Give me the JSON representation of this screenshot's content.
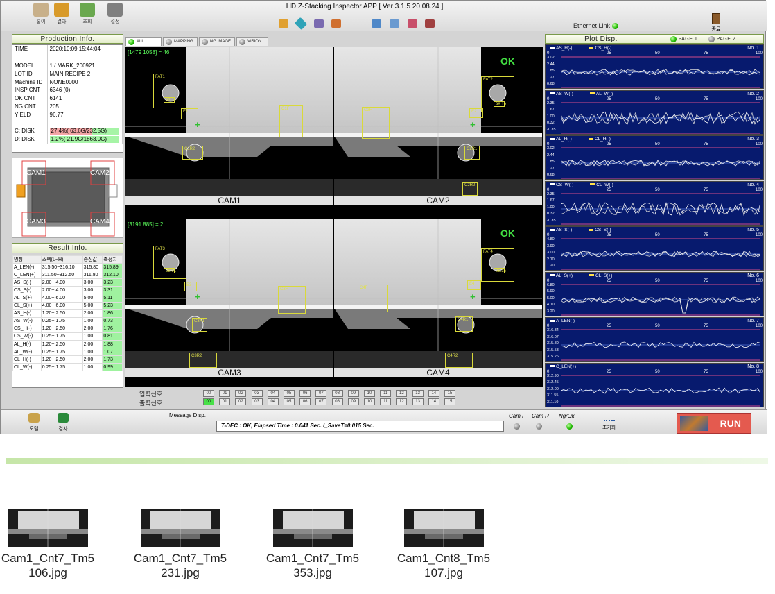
{
  "app": {
    "title": "HD  Z-Stacking Inspector APP  [ Ver 3.1.5 20.08.24 ]",
    "ethernet_label": "Ethernet Link",
    "exit_label": "종료"
  },
  "toolbar": [
    {
      "icon": "home-icon",
      "label": "홈이"
    },
    {
      "icon": "result-icon",
      "label": "결과"
    },
    {
      "icon": "search-icon",
      "label": "조회"
    },
    {
      "icon": "settings-icon",
      "label": "설정"
    }
  ],
  "production": {
    "title": "Production Info.",
    "rows": [
      {
        "k": "TIME",
        "v": "2020:10:09  15:44:04"
      },
      {
        "k": "",
        "v": ""
      },
      {
        "k": "MODEL",
        "v": "1 / MARK_200921"
      },
      {
        "k": "LOT ID",
        "v": "MAIN RECIPE 2"
      },
      {
        "k": "Machine ID",
        "v": "NONE0000"
      },
      {
        "k": "INSP CNT",
        "v": "6346 (0)"
      },
      {
        "k": "OK CNT",
        "v": "6141"
      },
      {
        "k": "NG CNT",
        "v": "205"
      },
      {
        "k": "YIELD",
        "v": "96.77"
      },
      {
        "k": "",
        "v": ""
      },
      {
        "k": "C: DISK",
        "v": "27.4%( 63.6G/232.5G)",
        "fill": 0.274,
        "color": "#f4a6a6"
      },
      {
        "k": "D: DISK",
        "v": "1.2%( 21.9G/1863.0G)",
        "fill": 0.012,
        "color": "#a6f4a6"
      }
    ]
  },
  "camlayout": [
    "CAM1",
    "CAM2",
    "CAM3",
    "CAM4"
  ],
  "result": {
    "title": "Result Info.",
    "headers": [
      "명칭",
      "스펙(L~H)",
      "중심값",
      "측정치"
    ],
    "rows": [
      [
        "A_LEN(-)",
        "315.50~316.10",
        "315.80",
        "315.89"
      ],
      [
        "C_LEN(+)",
        "311.50~312.50",
        "311.80",
        "312.10"
      ],
      [
        "AS_S(-)",
        "2.00~ 4.00",
        "3.00",
        "3.23"
      ],
      [
        "CS_S(-)",
        "2.00~ 4.00",
        "3.00",
        "3.31"
      ],
      [
        "AL_S(+)",
        "4.00~ 6.00",
        "5.00",
        "5.11"
      ],
      [
        "CL_S(+)",
        "4.00~ 6.00",
        "5.00",
        "5.23"
      ],
      [
        "AS_H(-)",
        "1.20~ 2.50",
        "2.00",
        "1.86"
      ],
      [
        "AS_W(-)",
        "0.25~ 1.75",
        "1.00",
        "0.73"
      ],
      [
        "CS_H(-)",
        "1.20~ 2.50",
        "2.00",
        "1.76"
      ],
      [
        "CS_W(-)",
        "0.25~ 1.75",
        "1.00",
        "0.81"
      ],
      [
        "AL_H(-)",
        "1.20~ 2.50",
        "2.00",
        "1.88"
      ],
      [
        "AL_W(-)",
        "0.25~ 1.75",
        "1.00",
        "1.07"
      ],
      [
        "CL_H(-)",
        "1.20~ 2.50",
        "2.00",
        "1.73"
      ],
      [
        "CL_W(-)",
        "0.25~ 1.75",
        "1.00",
        "0.99"
      ]
    ]
  },
  "tabs": [
    "ALL",
    "MAPPING",
    "NG IMAGE",
    "VISION"
  ],
  "cams": [
    {
      "label": "CAM1",
      "coord": "[1479  1058] = 46",
      "ok": "",
      "boxes": [
        "FAT1",
        "97.2",
        "C1F",
        "E1",
        "C1R2"
      ]
    },
    {
      "label": "CAM2",
      "coord": "",
      "ok": "OK",
      "boxes": [
        "FAT2",
        "98.19",
        "C2F",
        "E2",
        "C2R1",
        "C2R2"
      ]
    },
    {
      "label": "CAM3",
      "coord": "[3191  885] = 2",
      "ok": "",
      "boxes": [
        "FAT3",
        "98.91",
        "C3F",
        "E3",
        "C3R1",
        "C3R2"
      ]
    },
    {
      "label": "CAM4",
      "coord": "",
      "ok": "OK",
      "boxes": [
        "FAT4",
        "98.35",
        "C4F",
        "E4",
        "C4R1",
        "C4R2"
      ]
    }
  ],
  "io": {
    "input_label": "입력신호",
    "output_label": "출력신호",
    "codes": [
      "00",
      "01",
      "02",
      "03",
      "04",
      "05",
      "06",
      "07",
      "08",
      "09",
      "10",
      "11",
      "12",
      "13",
      "14",
      "15"
    ],
    "input_on": [],
    "output_on": [
      "00"
    ]
  },
  "plot": {
    "title": "Plot Disp.",
    "page1": "PAGE 1",
    "page2": "PAGE 2",
    "axis": [
      "0",
      "25",
      "50",
      "75",
      "100"
    ],
    "panels": [
      {
        "no": "No. 1",
        "s1": "AS_H(-)",
        "s2": "CS_H(-)",
        "y": [
          "3.02",
          "2.44",
          "1.85",
          "1.27",
          "0.68"
        ]
      },
      {
        "no": "No. 2",
        "s1": "AS_W(-)",
        "s2": "AL_W(-)",
        "y": [
          "2.35",
          "1.67",
          "1.00",
          "0.32",
          "-0.35"
        ]
      },
      {
        "no": "No. 3",
        "s1": "AL_H(-)",
        "s2": "CL_H(-)",
        "y": [
          "3.02",
          "2.44",
          "1.85",
          "1.27",
          "0.68"
        ]
      },
      {
        "no": "No. 4",
        "s1": "CS_W(-)",
        "s2": "CL_W(-)",
        "y": [
          "2.35",
          "1.67",
          "1.00",
          "0.32",
          "-0.35"
        ]
      },
      {
        "no": "No. 5",
        "s1": "AS_S(-)",
        "s2": "CS_S(-)",
        "y": [
          "4.80",
          "3.90",
          "3.00",
          "2.10",
          "1.20"
        ]
      },
      {
        "no": "No. 6",
        "s1": "AL_S(+)",
        "s2": "CL_S(+)",
        "y": [
          "6.80",
          "5.90",
          "5.00",
          "4.10",
          "3.20"
        ]
      },
      {
        "no": "No. 7",
        "s1": "A_LEN(-)",
        "s2": "",
        "y": [
          "316.34",
          "316.07",
          "315.80",
          "315.53",
          "315.26"
        ]
      },
      {
        "no": "No. 8",
        "s1": "C_LEN(+)",
        "s2": "",
        "y": [
          "312.90",
          "312.45",
          "312.00",
          "311.55",
          "311.10"
        ]
      }
    ]
  },
  "bottom": {
    "model_label": "모델",
    "inspect_label": "검사",
    "msg_label": "Message Disp.",
    "message": "T-DEC : OK,   Elapsed Time : 0.041 Sec. I_SaveT=0.015 Sec.",
    "camf": "Cam F",
    "camr": "Cam R",
    "ngok": "Ng/Ok",
    "reset_label": "초기화",
    "run": "RUN"
  },
  "files": [
    "Cam1_Cnt7_Tm5\n106.jpg",
    "Cam1_Cnt7_Tm5\n231.jpg",
    "Cam1_Cnt7_Tm5\n353.jpg",
    "Cam1_Cnt8_Tm5\n107.jpg"
  ],
  "colors": {
    "plot_bg": "#071a6e",
    "series1": "#ffffff",
    "series2": "#ffe04a",
    "ok_green": "#43e043",
    "run_red": "#e45a4f"
  }
}
